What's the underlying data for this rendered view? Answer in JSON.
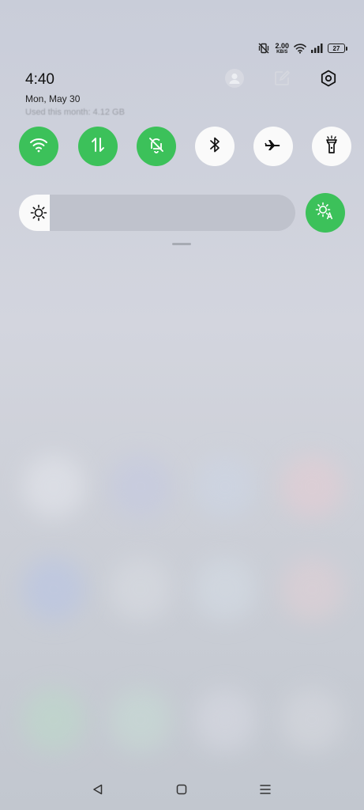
{
  "status_bar": {
    "icons": [
      "vibrate-off-icon",
      "wifi-icon",
      "signal-icon"
    ],
    "network_speed": "2.00",
    "network_speed_unit": "KB/S",
    "battery_level": "27"
  },
  "header": {
    "time": "4:40",
    "date": "Mon, May 30",
    "data_usage": "Used this month: 4.12 GB",
    "icons": [
      "user-icon",
      "edit-icon",
      "settings-icon"
    ]
  },
  "quick_toggles": [
    {
      "name": "wifi",
      "icon": "wifi-icon",
      "state": "on"
    },
    {
      "name": "mobile-data",
      "icon": "data-arrows-icon",
      "state": "on"
    },
    {
      "name": "silent",
      "icon": "bell-off-icon",
      "state": "on"
    },
    {
      "name": "bluetooth",
      "icon": "bluetooth-icon",
      "state": "off"
    },
    {
      "name": "airplane",
      "icon": "airplane-icon",
      "state": "off"
    },
    {
      "name": "flashlight",
      "icon": "flashlight-icon",
      "state": "off"
    }
  ],
  "brightness": {
    "level": 0.11,
    "auto_brightness": "on"
  },
  "colors": {
    "accent": "#3cc15a",
    "toggle_off": "#fafafa",
    "slider_track": "#bfc2cc"
  },
  "nav_bar": {
    "icons": [
      "back-icon",
      "home-icon",
      "recents-icon"
    ]
  }
}
